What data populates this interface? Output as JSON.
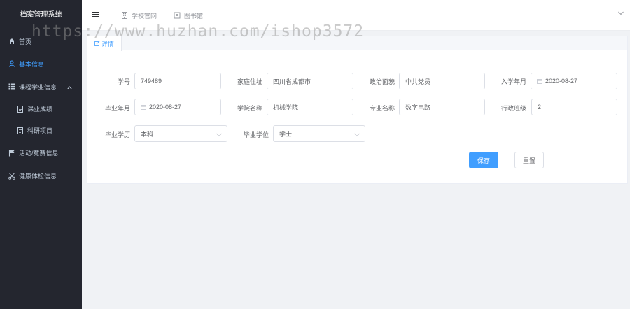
{
  "app": {
    "title": "档案管理系统"
  },
  "sidebar": {
    "items": [
      {
        "label": "首页",
        "icon": "home-icon"
      },
      {
        "label": "基本信息",
        "icon": "user-icon",
        "active": true
      },
      {
        "label": "课程学业信息",
        "icon": "grid-icon",
        "expanded": true
      },
      {
        "label": "课业成绩",
        "icon": "document-icon"
      },
      {
        "label": "科研项目",
        "icon": "document-icon"
      },
      {
        "label": "活动/竞赛信息",
        "icon": "flag-icon"
      },
      {
        "label": "健康体检信息",
        "icon": "scissors-icon"
      }
    ]
  },
  "header": {
    "links": [
      {
        "label": "学校官网",
        "icon": "building-icon"
      },
      {
        "label": "图书馆",
        "icon": "book-icon"
      }
    ]
  },
  "watermark": {
    "text": "https://www.huzhan.com/ishop3572"
  },
  "card": {
    "tab_label": "详情"
  },
  "form": {
    "student_no": {
      "label": "学号",
      "value": "749489"
    },
    "address": {
      "label": "家庭住址",
      "value": "四川省成都市"
    },
    "political": {
      "label": "政治面貌",
      "value": "中共党员"
    },
    "enroll_date": {
      "label": "入学年月",
      "value": "2020-08-27"
    },
    "grad_date": {
      "label": "毕业年月",
      "value": "2020-08-27"
    },
    "college": {
      "label": "学院名称",
      "value": "机械学院"
    },
    "major": {
      "label": "专业名称",
      "value": "数字电路"
    },
    "class_no": {
      "label": "行政班级",
      "value": "2"
    },
    "education": {
      "label": "毕业学历",
      "value": "本科"
    },
    "degree": {
      "label": "毕业学位",
      "value": "学士"
    }
  },
  "actions": {
    "save_label": "保存",
    "reset_label": "重置"
  },
  "colors": {
    "primary": "#409eff",
    "sidebar_bg": "#24262f",
    "page_bg": "#f0f2f5"
  }
}
